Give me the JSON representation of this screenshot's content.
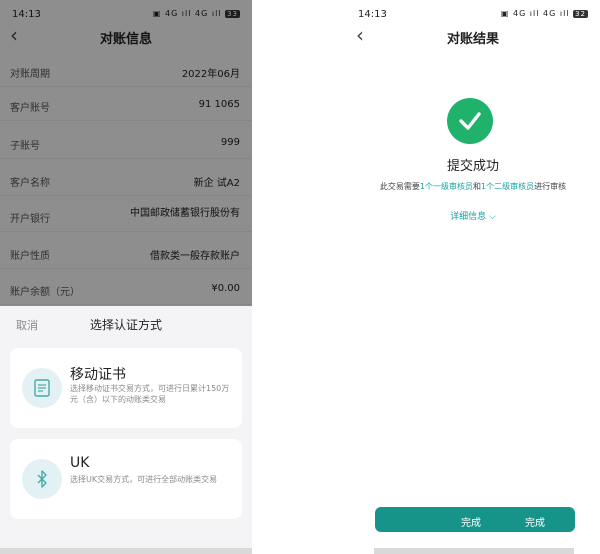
{
  "left": {
    "status_time": "14:13",
    "status_icons": "▣ 4G ıll 4G ıll",
    "battery": "33",
    "nav_back": "‹",
    "title": "对账信息",
    "rows": [
      {
        "label": "对账周期",
        "value": "2022年06月"
      },
      {
        "label": "客户账号",
        "value": "91              1065"
      },
      {
        "label": "子账号",
        "value": "999"
      },
      {
        "label": "客户名称",
        "value": "新企          试A2"
      },
      {
        "label": "开户银行",
        "value": "中国邮政储蓄银行股份有"
      },
      {
        "label": "账户性质",
        "value": "借款类一般存款账户"
      },
      {
        "label": "账户余额（元）",
        "value": "¥0.00"
      }
    ],
    "sheet": {
      "cancel": "取消",
      "title": "选择认证方式",
      "options": [
        {
          "title": "移动证书",
          "desc": "选择移动证书交易方式，可进行日累计150万元（含）以下的动账类交易",
          "icon": "certificate-icon"
        },
        {
          "title": "UK",
          "desc": "选择UK交易方式，可进行全部动账类交易",
          "icon": "bluetooth-icon"
        }
      ]
    }
  },
  "right": {
    "status_time": "14:13",
    "status_icons": "▣ 4G ıll 4G ıll",
    "battery": "32",
    "nav_back": "‹",
    "title": "对账结果",
    "headline": "提交成功",
    "note_pre": "此交易需要",
    "note_hl1": "1个一级审核员",
    "note_mid": "和",
    "note_hl2": "1个二级审核员",
    "note_post": "进行审核",
    "details": "详细信息 ⌵",
    "button_left": "完成",
    "button_right": "完成"
  },
  "colors": {
    "accent": "#17948a",
    "success": "#20b26b",
    "link": "#18a0a0"
  }
}
